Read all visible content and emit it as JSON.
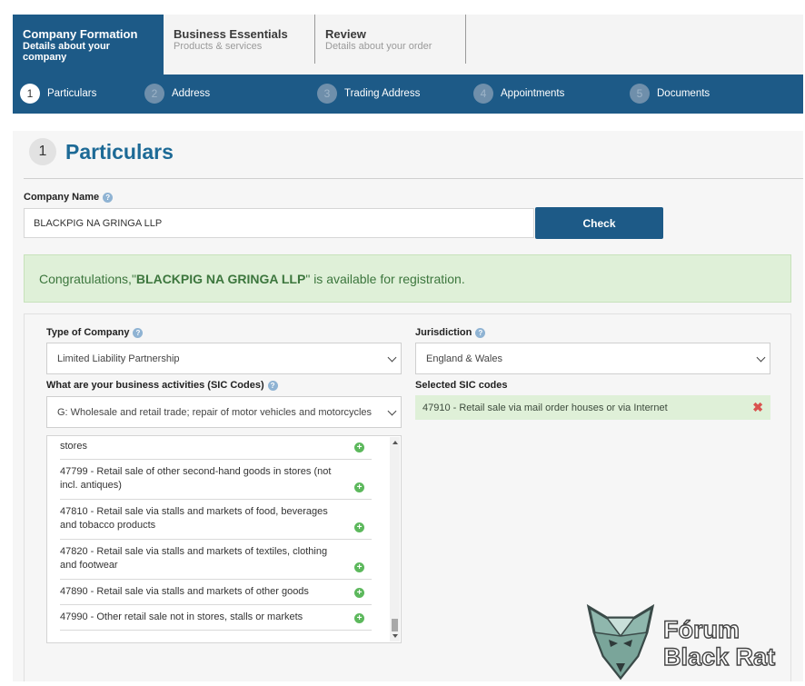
{
  "tabs": [
    {
      "title": "Company Formation",
      "subtitle": "Details about your company",
      "active": true
    },
    {
      "title": "Business Essentials",
      "subtitle": "Products & services",
      "active": false
    },
    {
      "title": "Review",
      "subtitle": "Details about your order",
      "active": false
    }
  ],
  "steps": [
    {
      "num": "1",
      "label": "Particulars",
      "active": true
    },
    {
      "num": "2",
      "label": "Address",
      "active": false
    },
    {
      "num": "3",
      "label": "Trading Address",
      "active": false
    },
    {
      "num": "4",
      "label": "Appointments",
      "active": false
    },
    {
      "num": "5",
      "label": "Documents",
      "active": false
    }
  ],
  "section": {
    "num": "1",
    "title": "Particulars"
  },
  "company_name": {
    "label": "Company Name",
    "value": "BLACKPIG NA GRINGA LLP",
    "check_label": "Check"
  },
  "availability": {
    "prefix": "Congratulations,\"",
    "name": "BLACKPIG NA GRINGA LLP",
    "suffix": "\" is available for registration."
  },
  "type_of_company": {
    "label": "Type of Company",
    "selected": "Limited Liability Partnership"
  },
  "jurisdiction": {
    "label": "Jurisdiction",
    "selected": "England & Wales"
  },
  "sic": {
    "label": "What are your business activities (SIC Codes)",
    "selected_group": "G: Wholesale and retail trade; repair of motor vehicles and motorcycles",
    "selected_label": "Selected SIC codes",
    "selected_codes": [
      "47910 - Retail sale via mail order houses or via Internet"
    ],
    "options": [
      "stores",
      "47799 - Retail sale of other second-hand goods in stores (not incl. antiques)",
      "47810 - Retail sale via stalls and markets of food, beverages and tobacco products",
      "47820 - Retail sale via stalls and markets of textiles, clothing and footwear",
      "47890 - Retail sale via stalls and markets of other goods",
      "47990 - Other retail sale not in stores, stalls or markets"
    ]
  },
  "icons": {
    "help": "help-icon",
    "add": "add-icon",
    "remove": "remove-icon"
  },
  "colors": {
    "primary": "#1d5a87",
    "title": "#1d6a96",
    "success_bg": "#dff0d8",
    "success_text": "#3c763d",
    "add": "#5cb85c",
    "remove": "#d9534f"
  },
  "watermark": {
    "line1": "Fórum",
    "line2": "Black Rat"
  }
}
